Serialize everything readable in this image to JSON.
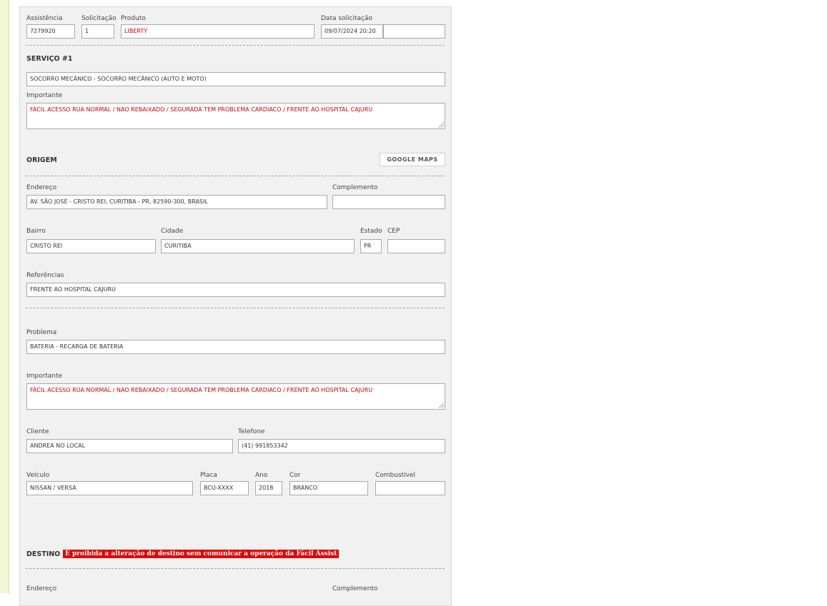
{
  "header": {
    "assistencia_label": "Assistência",
    "assistencia_value": "7279920",
    "solicitacao_label": "Solicitação",
    "solicitacao_value": "1",
    "produto_label": "Produto",
    "produto_value": "LIBERTY",
    "data_label": "Data solicitação",
    "data_value": "09/07/2024 20:20",
    "data_extra_value": ""
  },
  "servico": {
    "title": "SERVIÇO #1",
    "value": "SOCORRO MECÂNICO - SOCORRO MECÂNICO (AUTO E MOTO)",
    "importante_label": "Importante",
    "importante_value": "FÁCIL ACESSO RUA NORMAL / NAO REBAIXADO / SEGURADA TEM PROBLEMA CARDIACO / FRENTE AO HOSPITAL CAJURU"
  },
  "origem": {
    "title": "ORIGEM",
    "maps_button": "GOOGLE MAPS",
    "endereco_label": "Endereço",
    "endereco_value": "AV. SÃO JOSÉ - CRISTO REI, CURITIBA - PR, 82590-300, BRASIL",
    "complemento_label": "Complemento",
    "complemento_value": "",
    "bairro_label": "Bairro",
    "bairro_value": "CRISTO REI",
    "cidade_label": "Cidade",
    "cidade_value": "CURITIBA",
    "estado_label": "Estado",
    "estado_value": "PR",
    "cep_label": "CEP",
    "cep_value": "",
    "referencias_label": "Referências",
    "referencias_value": "FRENTE AO HOSPITAL CAJURU"
  },
  "problema": {
    "label": "Problema",
    "value": "BATERIA - RECARGA DE BATERIA",
    "importante_label": "Importante",
    "importante_value": "FÁCIL ACESSO RUA NORMAL / NAO REBAIXADO / SEGURADA TEM PROBLEMA CARDIACO / FRENTE AO HOSPITAL CAJURU"
  },
  "cliente": {
    "cliente_label": "Cliente",
    "cliente_value": "ANDREA NO LOCAL",
    "telefone_label": "Telefone",
    "telefone_value": "(41) 991853342"
  },
  "veiculo": {
    "veiculo_label": "Veículo",
    "veiculo_value": "NISSAN / VERSA",
    "placa_label": "Placa",
    "placa_value": "BCU-XXXX",
    "ano_label": "Ano",
    "ano_value": "2018",
    "cor_label": "Cor",
    "cor_value": "BRANCO",
    "combustivel_label": "Combustível",
    "combustivel_value": ""
  },
  "destino": {
    "title": "DESTINO",
    "warning": "É proibida a alteração de destino sem comunicar a operação da Fácil Assist",
    "endereco_label": "Endereço",
    "complemento_label": "Complemento"
  },
  "colors": {
    "sidebar_strip": "#eef7d2",
    "panel_bg": "#f1f1f1",
    "alert_red": "#e00000",
    "text_red": "#cc0000"
  }
}
